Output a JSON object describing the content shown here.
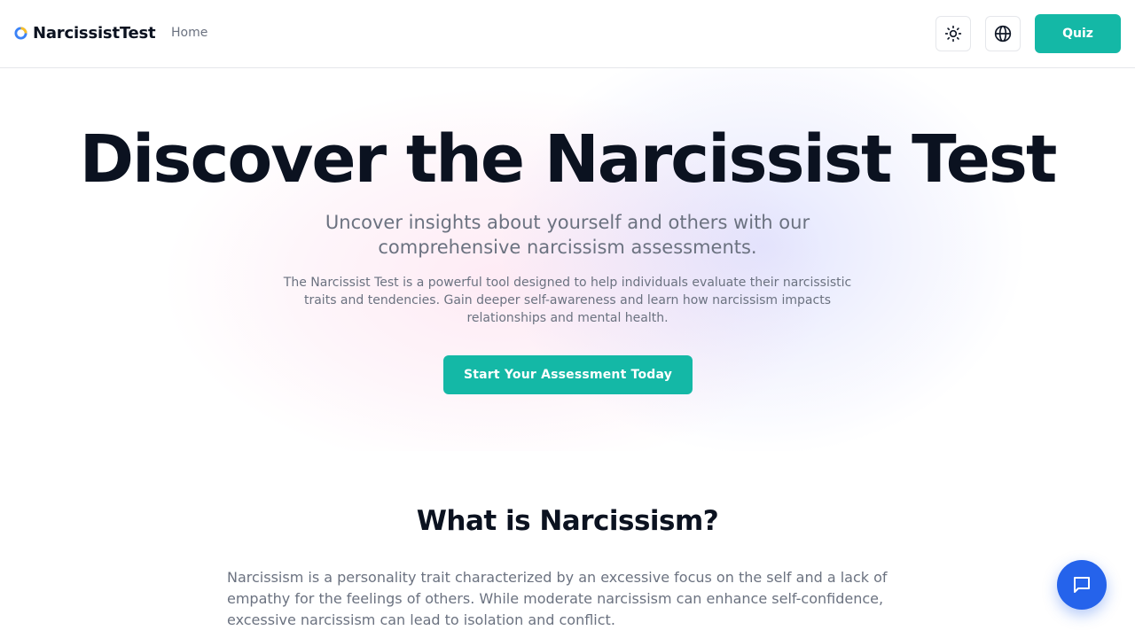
{
  "header": {
    "brand": "NarcissistTest",
    "nav_home": "Home",
    "quiz_label": "Quiz",
    "theme_icon": "sun-icon",
    "language_icon": "globe-icon"
  },
  "hero": {
    "title": "Discover the Narcissist Test",
    "subtitle": "Uncover insights about yourself and others with our comprehensive narcissism assessments.",
    "description": "The Narcissist Test is a powerful tool designed to help individuals evaluate their narcissistic traits and tendencies. Gain deeper self-awareness and learn how narcissism impacts relationships and mental health.",
    "cta_label": "Start Your Assessment Today"
  },
  "section": {
    "title": "What is Narcissism?",
    "text": "Narcissism is a personality trait characterized by an excessive focus on the self and a lack of empathy for the feelings of others. While moderate narcissism can enhance self-confidence, excessive narcissism can lead to isolation and conflict."
  },
  "chat": {
    "icon": "chat-bubble-icon"
  },
  "colors": {
    "accent": "#14b8a6",
    "chat": "#2563eb",
    "text": "#0b1220",
    "muted": "#6b7280"
  }
}
